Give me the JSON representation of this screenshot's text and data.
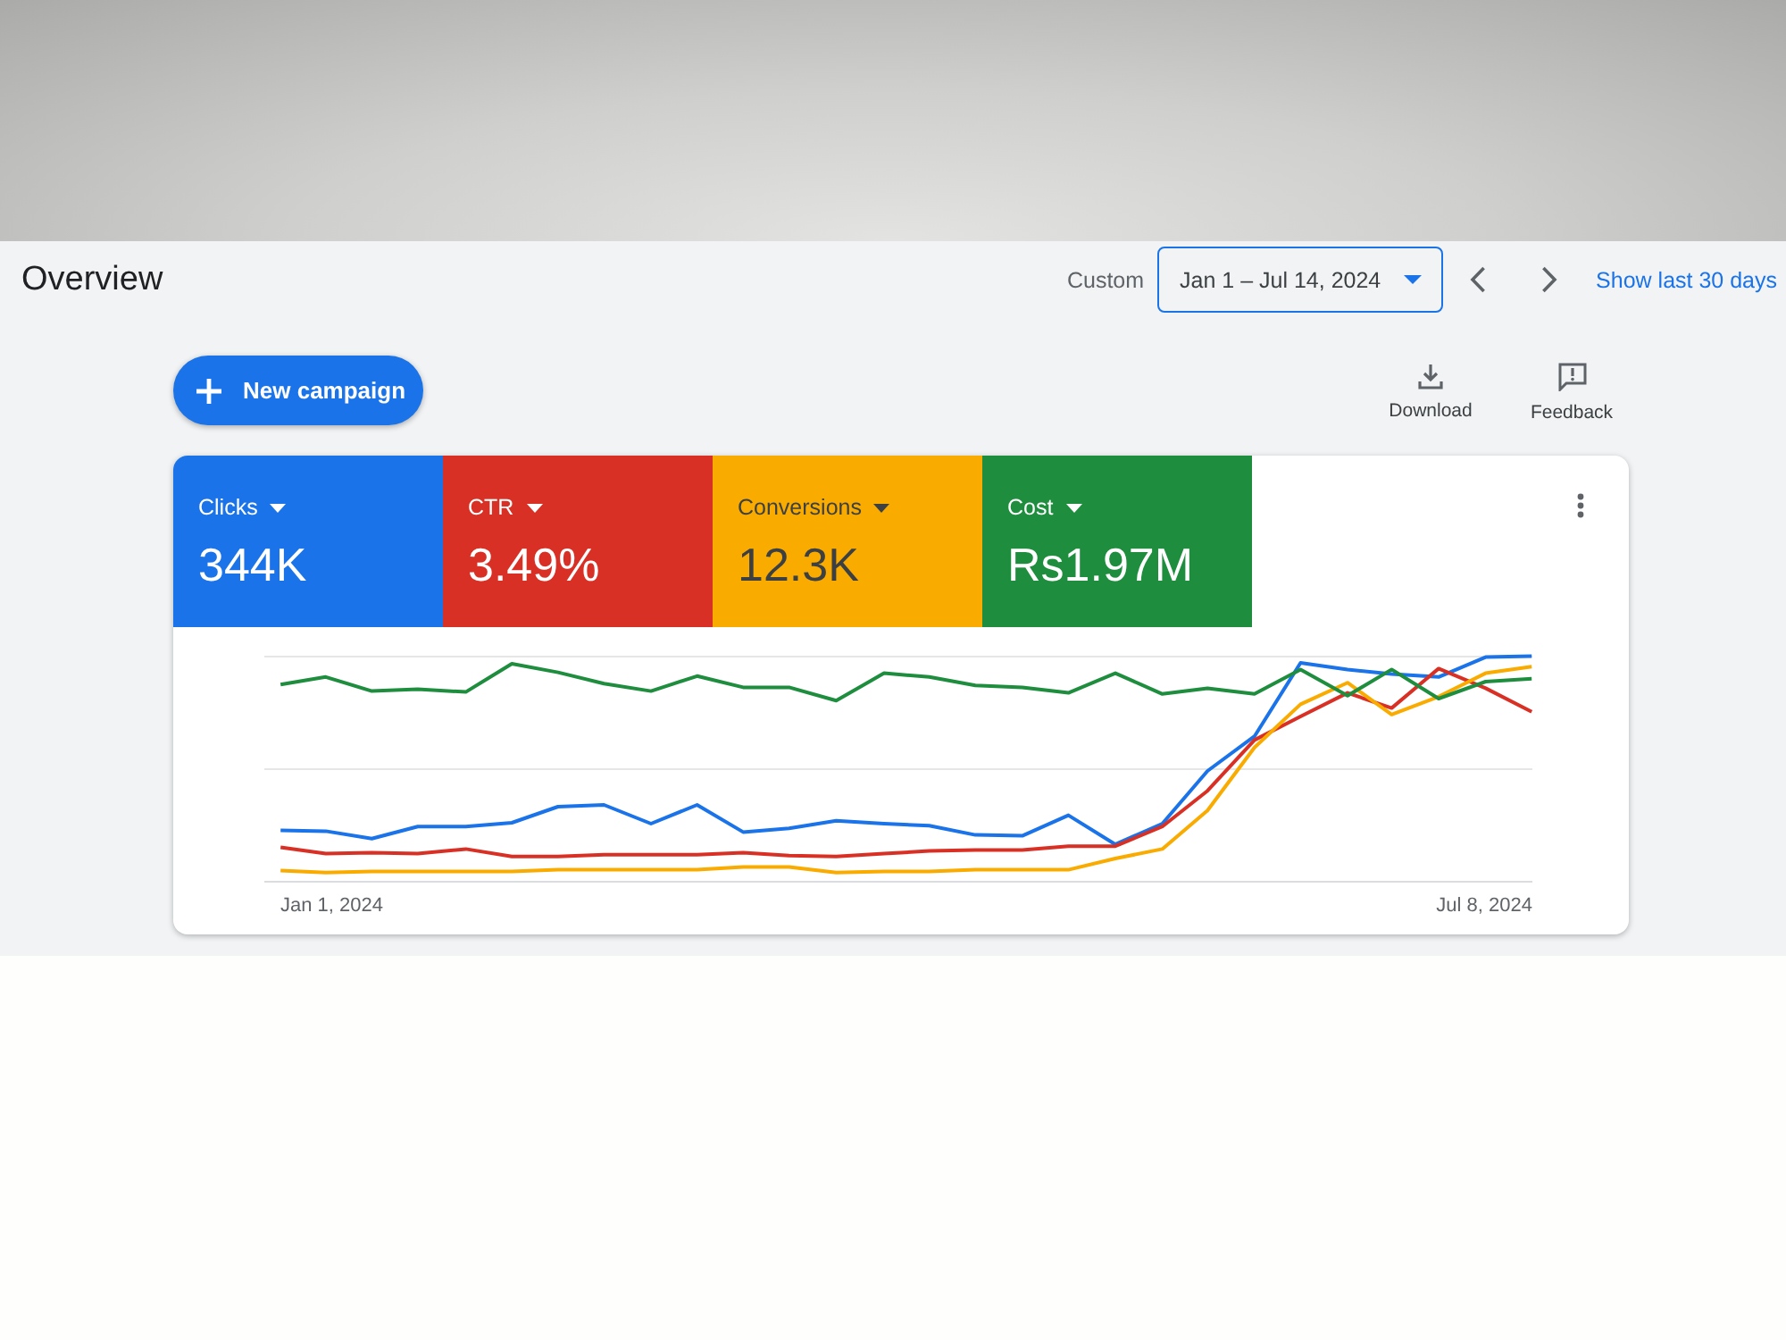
{
  "page": {
    "title": "Overview"
  },
  "date_range": {
    "label": "Custom",
    "value": "Jan 1 – Jul 14, 2024",
    "link": "Show last 30 days"
  },
  "actions": {
    "new_button": "New campaign",
    "tools": [
      {
        "kind": "download",
        "label": "Download"
      },
      {
        "kind": "feedback",
        "label": "Feedback"
      }
    ]
  },
  "metrics": [
    {
      "label": "Clicks",
      "value": "344K",
      "color": "#1a73e8",
      "selected": true
    },
    {
      "label": "CTR",
      "value": "3.49%",
      "color": "#d93025",
      "selected": true
    },
    {
      "label": "Conversions",
      "value": "12.3K",
      "color": "#f9ab00",
      "selected": true
    },
    {
      "label": "Cost",
      "value": "Rs1.97M",
      "color": "#1e8e3e",
      "selected": true
    }
  ],
  "chart": {
    "x_start_label": "Jan 1, 2024",
    "x_end_label": "Jul 8, 2024"
  }
}
